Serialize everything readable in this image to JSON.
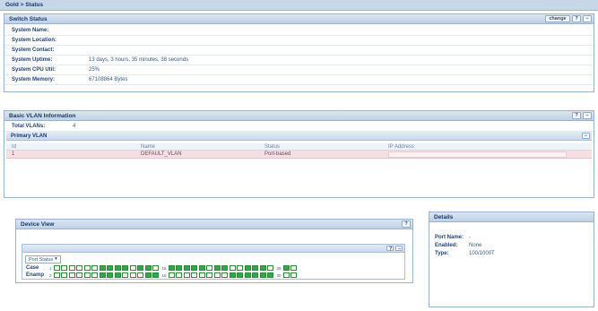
{
  "breadcrumb": "Gold > Status",
  "switch_status": {
    "title": "Switch Status",
    "change_btn": "change",
    "help_btn": "?",
    "collapse_btn": "−",
    "rows": [
      {
        "label": "System Name:",
        "value": ""
      },
      {
        "label": "System Location:",
        "value": ""
      },
      {
        "label": "System Contact:",
        "value": ""
      },
      {
        "label": "System Uptime:",
        "value": "13 days, 3 hours, 35 minutes, 38 seconds"
      },
      {
        "label": "System CPU Util:",
        "value": "25%"
      },
      {
        "label": "System Memory:",
        "value": "67108864 Bytes"
      }
    ]
  },
  "vlan_info": {
    "title": "Basic VLAN Information",
    "help_btn": "?",
    "collapse_btn": "−",
    "total_label": "Total VLANs:",
    "total_value": "4",
    "primary_title": "Primary VLAN",
    "primary_collapse": "−",
    "columns": [
      "Id",
      "Name",
      "Status",
      "IP Address"
    ],
    "rows": [
      [
        "1",
        "DEFAULT_VLAN",
        "Port-based",
        ""
      ]
    ]
  },
  "device_view": {
    "title": "Device View",
    "help_btn": "?",
    "inner_help": "?",
    "inner_collapse": "−",
    "select_value": "Port Status",
    "row1_label": "Case",
    "row2_label": "Enamp",
    "row1_start": "1",
    "row1_mid": "15",
    "row1_end": "29",
    "row2_start": "2",
    "row2_mid": "16",
    "row2_end": "30",
    "row1_ports_a": [
      0,
      0,
      0,
      0,
      0,
      0,
      1,
      1,
      1,
      1,
      0,
      1,
      1,
      0
    ],
    "row1_ports_b": [
      1,
      1,
      1,
      1,
      1,
      0,
      1,
      1,
      0,
      0,
      1,
      1,
      1,
      0
    ],
    "row1_ports_c": [
      1,
      0
    ],
    "row2_ports_a": [
      0,
      0,
      0,
      0,
      0,
      0,
      1,
      1,
      1,
      0,
      0,
      0,
      1,
      1
    ],
    "row2_ports_b": [
      0,
      0,
      0,
      0,
      0,
      0,
      0,
      0,
      1,
      1,
      1,
      1,
      1,
      1
    ],
    "row2_ports_c": [
      0,
      0
    ]
  },
  "details": {
    "title": "Details",
    "rows": [
      {
        "label": "Port Name:",
        "value": "-"
      },
      {
        "label": "Enabled:",
        "value": "None"
      },
      {
        "label": "Type:",
        "value": "100/1000T"
      }
    ]
  },
  "colors": {
    "port_up": "#2ea84a",
    "port_down": "#ffffff",
    "header_bg": "#bdd0e8",
    "selected_row": "#f6dfe3"
  }
}
